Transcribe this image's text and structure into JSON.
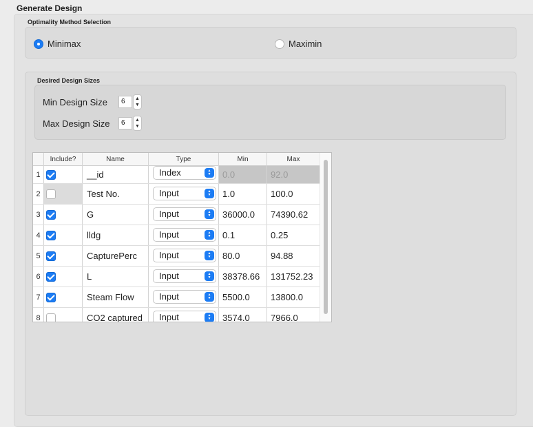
{
  "header": {
    "title": "Generate Design"
  },
  "optimality": {
    "group_label": "Optimality Method Selection",
    "options": [
      {
        "label": "Minimax",
        "selected": true
      },
      {
        "label": "Maximin",
        "selected": false
      }
    ]
  },
  "design_sizes": {
    "group_label": "Desired Design Sizes",
    "min_label": "Min Design Size",
    "min_value": "6",
    "max_label": "Max Design Size",
    "max_value": "6"
  },
  "table": {
    "columns": [
      "Include?",
      "Name",
      "Type",
      "Min",
      "Max"
    ],
    "rows": [
      {
        "num": "1",
        "include": true,
        "name": "__id",
        "type": "Index",
        "min": "0.0",
        "max": "92.0",
        "disabled": true
      },
      {
        "num": "2",
        "include": false,
        "name": "Test No.",
        "type": "Input",
        "min": "1.0",
        "max": "100.0"
      },
      {
        "num": "3",
        "include": true,
        "name": "G",
        "type": "Input",
        "min": "36000.0",
        "max": "74390.62"
      },
      {
        "num": "4",
        "include": true,
        "name": "lldg",
        "type": "Input",
        "min": "0.1",
        "max": "0.25"
      },
      {
        "num": "5",
        "include": true,
        "name": "CapturePerc",
        "type": "Input",
        "min": "80.0",
        "max": "94.88"
      },
      {
        "num": "6",
        "include": true,
        "name": "L",
        "type": "Input",
        "min": "38378.66",
        "max": "131752.23"
      },
      {
        "num": "7",
        "include": true,
        "name": "Steam Flow",
        "type": "Input",
        "min": "5500.0",
        "max": "13800.0"
      },
      {
        "num": "8",
        "include": false,
        "name": "CO2 captured",
        "type": "Input",
        "min": "3574.0",
        "max": "7966.0"
      }
    ]
  },
  "colors": {
    "accent": "#1c7cf4",
    "panel": "#e3e3e3",
    "disabled_cell": "#c6c6c6"
  }
}
